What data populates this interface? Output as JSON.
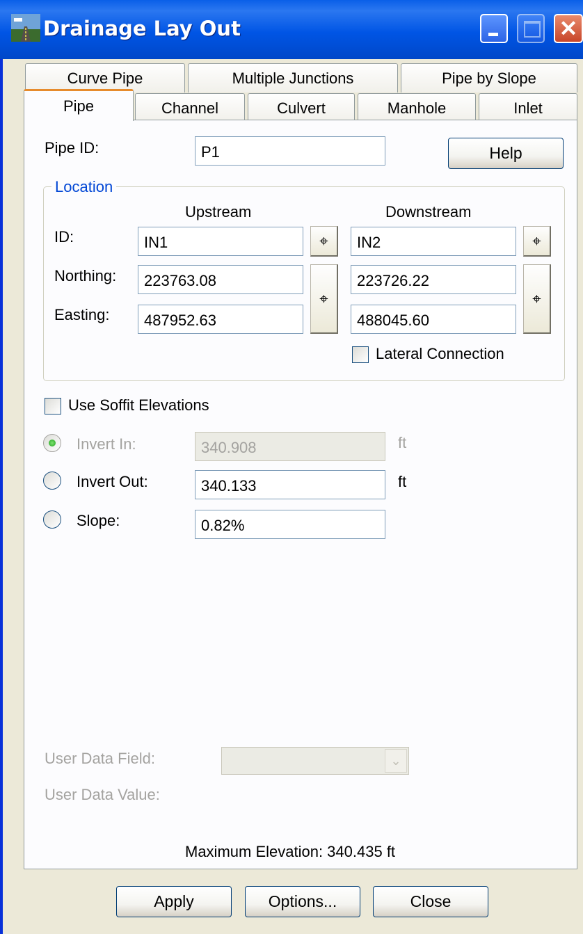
{
  "window": {
    "title": "Drainage Lay Out",
    "accent": "#0055e5",
    "icons": {
      "app": "road-icon",
      "minimize": "minimize-icon",
      "maximize": "maximize-icon",
      "close": "close-icon"
    }
  },
  "tabs": {
    "row1": [
      {
        "label": "Curve Pipe"
      },
      {
        "label": "Multiple Junctions"
      },
      {
        "label": "Pipe by Slope"
      }
    ],
    "row2": [
      {
        "label": "Pipe",
        "active": true
      },
      {
        "label": "Channel"
      },
      {
        "label": "Culvert"
      },
      {
        "label": "Manhole"
      },
      {
        "label": "Inlet"
      }
    ]
  },
  "pipe": {
    "id_label": "Pipe ID:",
    "id_value": "P1",
    "help_label": "Help"
  },
  "location": {
    "title": "Location",
    "upstream_header": "Upstream",
    "downstream_header": "Downstream",
    "id_label": "ID:",
    "northing_label": "Northing:",
    "easting_label": "Easting:",
    "upstream": {
      "id": "IN1",
      "northing": "223763.08",
      "easting": "487952.63"
    },
    "downstream": {
      "id": "IN2",
      "northing": "223726.22",
      "easting": "488045.60"
    },
    "lateral_label": "Lateral Connection",
    "lateral_checked": false,
    "pick_icon": "crosshair-pick-icon"
  },
  "elevation": {
    "soffit_label": "Use Soffit Elevations",
    "soffit_checked": false,
    "invert_in_label": "Invert In:",
    "invert_in_value": "340.908",
    "invert_out_label": "Invert Out:",
    "invert_out_value": "340.133",
    "slope_label": "Slope:",
    "slope_value": "0.82%",
    "unit": "ft",
    "selected": "invert_in"
  },
  "user_data": {
    "field_label": "User Data Field:",
    "value_label": "User Data Value:",
    "field_value": ""
  },
  "status": {
    "max_elevation": "Maximum Elevation: 340.435 ft"
  },
  "footer": {
    "apply_label": "Apply",
    "options_label": "Options...",
    "close_label": "Close"
  }
}
